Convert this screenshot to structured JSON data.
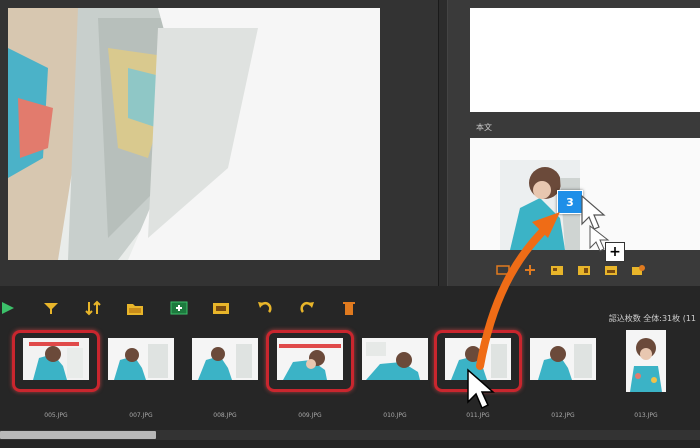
{
  "right_pane": {
    "section_label": "本文"
  },
  "drag": {
    "badge_number": "3",
    "plus_symbol": "+"
  },
  "filmstrip": {
    "status_text": "認込枚数 全体:31枚 (11",
    "thumbnails": [
      {
        "label": "005.JPG",
        "selected": true
      },
      {
        "label": "007.JPG",
        "selected": false
      },
      {
        "label": "008.JPG",
        "selected": false
      },
      {
        "label": "009.JPG",
        "selected": true
      },
      {
        "label": "010.JPG",
        "selected": false
      },
      {
        "label": "011.JPG",
        "selected": true
      },
      {
        "label": "012.JPG",
        "selected": false
      },
      {
        "label": "013.JPG",
        "selected": false
      }
    ]
  },
  "colors": {
    "selection_red": "#c9262e",
    "drag_arrow_orange": "#ef6c16",
    "badge_blue": "#1e8fe8",
    "toolbar_yellow": "#e8b52a",
    "toolbar_orange": "#e07a1f"
  },
  "icons": {
    "film_toolbar": [
      "play-icon",
      "filter-icon",
      "sort-icon",
      "folder-icon",
      "add-image-icon",
      "image-icon",
      "rotate-left-icon",
      "rotate-right-icon",
      "delete-icon"
    ],
    "right_toolbar": [
      "text-frame-icon",
      "add-icon",
      "layout-1-icon",
      "layout-2-icon",
      "layout-3-icon",
      "photo-edit-icon"
    ]
  }
}
